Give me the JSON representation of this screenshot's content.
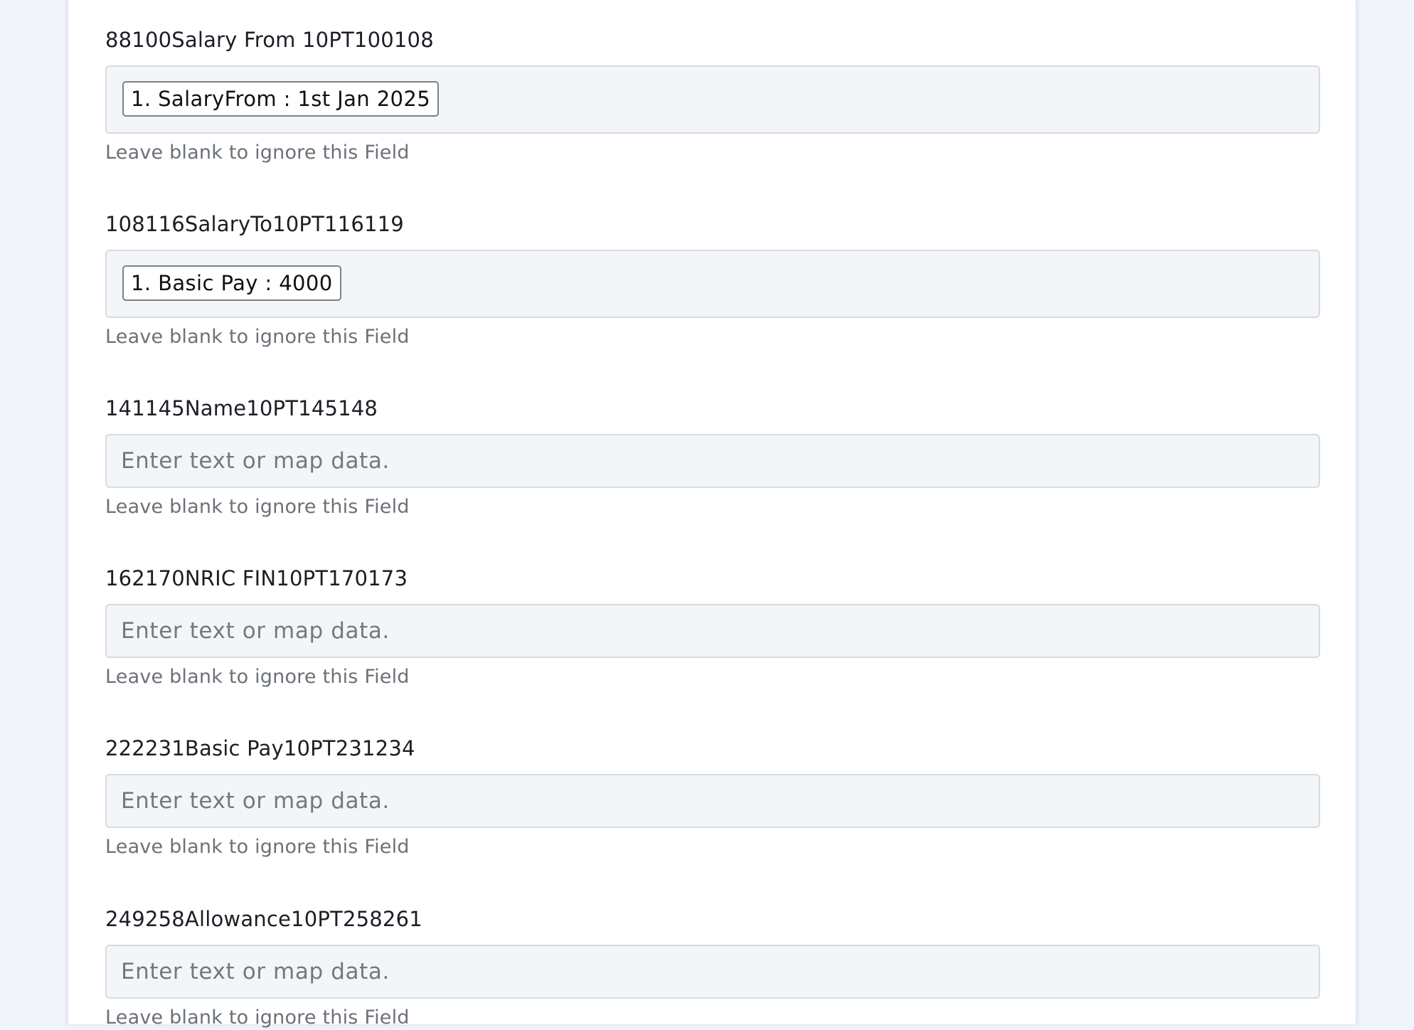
{
  "fields": [
    {
      "label": "88100Salary From 10PT100108",
      "chip": "1. SalaryFrom : 1st Jan 2025",
      "help": "Leave blank to ignore this Field"
    },
    {
      "label": "108116SalaryTo10PT116119",
      "chip": "1. Basic Pay : 4000",
      "help": "Leave blank to ignore this Field"
    },
    {
      "label": "141145Name10PT145148",
      "placeholder": "Enter text or map data.",
      "help": "Leave blank to ignore this Field"
    },
    {
      "label": "162170NRIC FIN10PT170173",
      "placeholder": "Enter text or map data.",
      "help": "Leave blank to ignore this Field"
    },
    {
      "label": "222231Basic Pay10PT231234",
      "placeholder": "Enter text or map data.",
      "help": "Leave blank to ignore this Field"
    },
    {
      "label": "249258Allowance10PT258261",
      "placeholder": "Enter text or map data.",
      "help": "Leave blank to ignore this Field"
    }
  ]
}
